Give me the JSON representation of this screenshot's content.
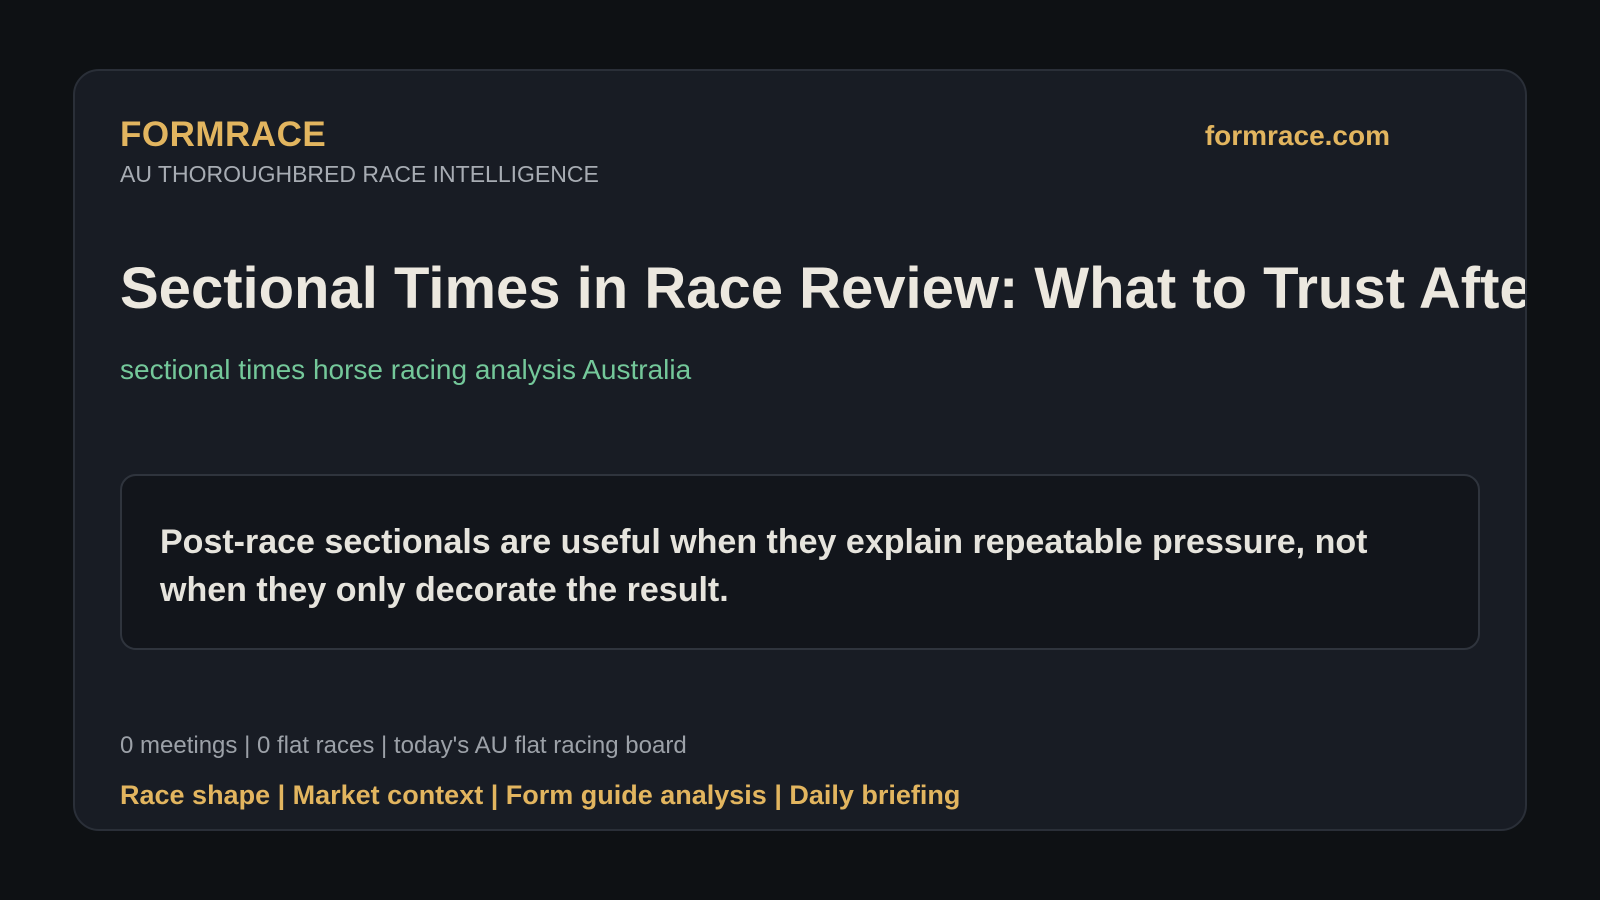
{
  "header": {
    "brand": "FORMRACE",
    "tagline": "AU THOROUGHBRED RACE INTELLIGENCE",
    "domain": "formrace.com"
  },
  "article": {
    "headline": "Sectional Times in Race Review: What to Trust After the Run",
    "keyword": "sectional times horse racing analysis Australia",
    "quote": "Post-race sectionals are useful when they explain repeatable pressure, not when they only decorate the result."
  },
  "footer": {
    "stats": "0 meetings | 0 flat races | today's AU flat racing board",
    "nav": "Race shape | Market context | Form guide analysis | Daily briefing"
  },
  "colors": {
    "background": "#0e1114",
    "card": "#181c24",
    "accent_gold": "#e2b55f",
    "accent_green": "#74c89a",
    "headline": "#ece8df"
  }
}
